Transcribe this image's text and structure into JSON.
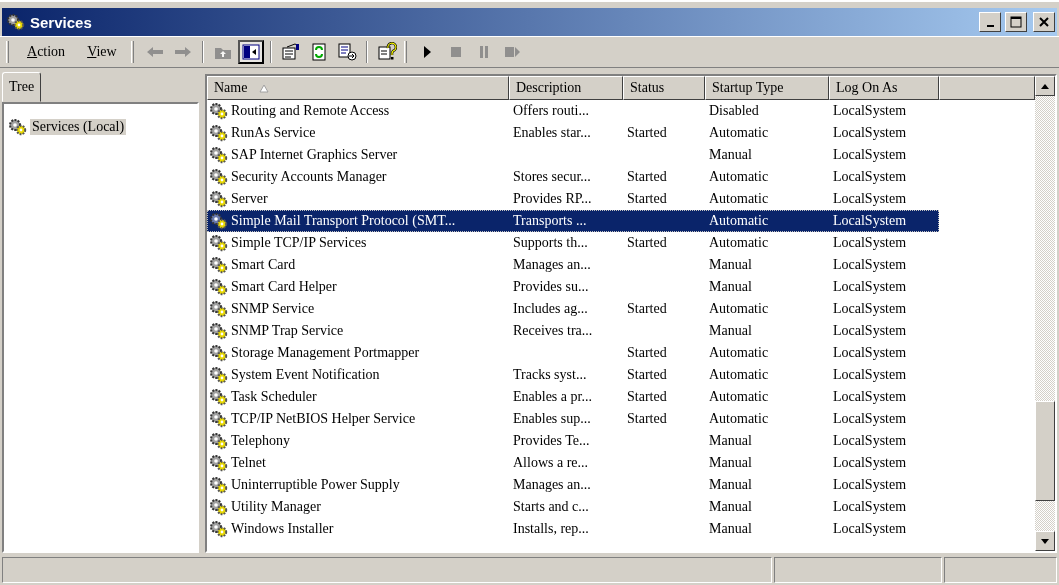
{
  "window": {
    "title": "Services"
  },
  "menu": [
    {
      "label": "Action"
    },
    {
      "label": "View"
    }
  ],
  "toolbar": [
    {
      "kind": "back",
      "disabled": true,
      "pressed": false
    },
    {
      "kind": "forward",
      "disabled": true,
      "pressed": false
    },
    {
      "kind": "sep"
    },
    {
      "kind": "up",
      "disabled": true,
      "pressed": false
    },
    {
      "kind": "tree",
      "disabled": false,
      "pressed": true
    },
    {
      "kind": "sep"
    },
    {
      "kind": "properties",
      "disabled": false,
      "pressed": false
    },
    {
      "kind": "refresh",
      "disabled": false,
      "pressed": false
    },
    {
      "kind": "export",
      "disabled": false,
      "pressed": false
    },
    {
      "kind": "sep"
    },
    {
      "kind": "help",
      "disabled": false,
      "pressed": false
    },
    {
      "kind": "bar"
    },
    {
      "kind": "play",
      "disabled": false,
      "pressed": false
    },
    {
      "kind": "stop",
      "disabled": true,
      "pressed": false
    },
    {
      "kind": "pause",
      "disabled": true,
      "pressed": false
    },
    {
      "kind": "resume",
      "disabled": true,
      "pressed": false
    }
  ],
  "tree_pane": {
    "tab": "Tree",
    "items": [
      {
        "label": "Services (Local)",
        "selected": true
      }
    ]
  },
  "table": {
    "columns": [
      {
        "label": "Name",
        "sorted": true
      },
      {
        "label": "Description",
        "sorted": false
      },
      {
        "label": "Status",
        "sorted": false
      },
      {
        "label": "Startup Type",
        "sorted": false
      },
      {
        "label": "Log On As",
        "sorted": false
      }
    ],
    "rows": [
      {
        "name": "Routing and Remote Access",
        "description": "Offers routi...",
        "status": "",
        "startup_type": "Disabled",
        "log_on_as": "LocalSystem",
        "selected": false
      },
      {
        "name": "RunAs Service",
        "description": "Enables star...",
        "status": "Started",
        "startup_type": "Automatic",
        "log_on_as": "LocalSystem",
        "selected": false
      },
      {
        "name": "SAP Internet Graphics Server",
        "description": "",
        "status": "",
        "startup_type": "Manual",
        "log_on_as": "LocalSystem",
        "selected": false
      },
      {
        "name": "Security Accounts Manager",
        "description": "Stores secur...",
        "status": "Started",
        "startup_type": "Automatic",
        "log_on_as": "LocalSystem",
        "selected": false
      },
      {
        "name": "Server",
        "description": "Provides RP...",
        "status": "Started",
        "startup_type": "Automatic",
        "log_on_as": "LocalSystem",
        "selected": false
      },
      {
        "name": "Simple Mail Transport Protocol (SMT...",
        "description": "Transports ...",
        "status": "",
        "startup_type": "Automatic",
        "log_on_as": "LocalSystem",
        "selected": true
      },
      {
        "name": "Simple TCP/IP Services",
        "description": "Supports th...",
        "status": "Started",
        "startup_type": "Automatic",
        "log_on_as": "LocalSystem",
        "selected": false
      },
      {
        "name": "Smart Card",
        "description": "Manages an...",
        "status": "",
        "startup_type": "Manual",
        "log_on_as": "LocalSystem",
        "selected": false
      },
      {
        "name": "Smart Card Helper",
        "description": "Provides su...",
        "status": "",
        "startup_type": "Manual",
        "log_on_as": "LocalSystem",
        "selected": false
      },
      {
        "name": "SNMP Service",
        "description": "Includes ag...",
        "status": "Started",
        "startup_type": "Automatic",
        "log_on_as": "LocalSystem",
        "selected": false
      },
      {
        "name": "SNMP Trap Service",
        "description": "Receives tra...",
        "status": "",
        "startup_type": "Manual",
        "log_on_as": "LocalSystem",
        "selected": false
      },
      {
        "name": "Storage Management Portmapper",
        "description": "",
        "status": "Started",
        "startup_type": "Automatic",
        "log_on_as": "LocalSystem",
        "selected": false
      },
      {
        "name": "System Event Notification",
        "description": "Tracks syst...",
        "status": "Started",
        "startup_type": "Automatic",
        "log_on_as": "LocalSystem",
        "selected": false
      },
      {
        "name": "Task Scheduler",
        "description": "Enables a pr...",
        "status": "Started",
        "startup_type": "Automatic",
        "log_on_as": "LocalSystem",
        "selected": false
      },
      {
        "name": "TCP/IP NetBIOS Helper Service",
        "description": "Enables sup...",
        "status": "Started",
        "startup_type": "Automatic",
        "log_on_as": "LocalSystem",
        "selected": false
      },
      {
        "name": "Telephony",
        "description": "Provides Te...",
        "status": "",
        "startup_type": "Manual",
        "log_on_as": "LocalSystem",
        "selected": false
      },
      {
        "name": "Telnet",
        "description": "Allows a re...",
        "status": "",
        "startup_type": "Manual",
        "log_on_as": "LocalSystem",
        "selected": false
      },
      {
        "name": "Uninterruptible Power Supply",
        "description": "Manages an...",
        "status": "",
        "startup_type": "Manual",
        "log_on_as": "LocalSystem",
        "selected": false
      },
      {
        "name": "Utility Manager",
        "description": "Starts and c...",
        "status": "",
        "startup_type": "Manual",
        "log_on_as": "LocalSystem",
        "selected": false
      },
      {
        "name": "Windows Installer",
        "description": "Installs, rep...",
        "status": "",
        "startup_type": "Manual",
        "log_on_as": "LocalSystem",
        "selected": false
      }
    ]
  }
}
